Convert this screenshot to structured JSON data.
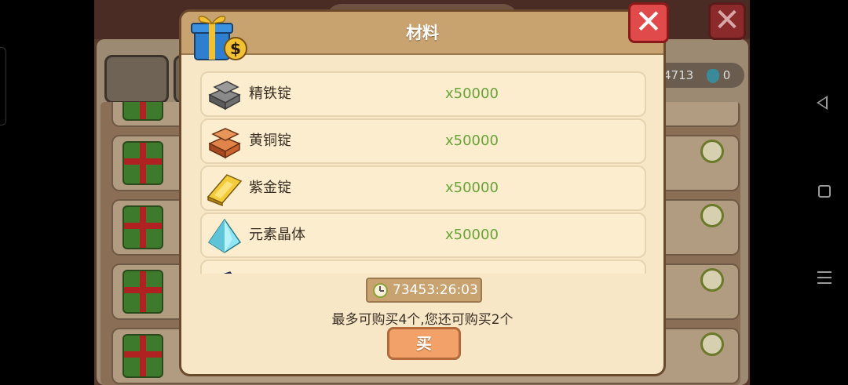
{
  "dialog": {
    "title": "材料",
    "items": [
      {
        "name": "精铁锭",
        "qty": "x50000",
        "icon": "iron-ingot-icon",
        "color": "#6e6e6e"
      },
      {
        "name": "黄铜锭",
        "qty": "x50000",
        "icon": "copper-ingot-icon",
        "color": "#c8632f"
      },
      {
        "name": "紫金锭",
        "qty": "x50000",
        "icon": "gold-ingot-icon",
        "color": "#e7b21e"
      },
      {
        "name": "元素晶体",
        "qty": "x50000",
        "icon": "element-crystal-icon",
        "color": "#5fd0e6"
      }
    ],
    "timer": "73453:26:03",
    "limit_text": "最多可购买4个,您还可购买2个",
    "buy_label": "买"
  },
  "background": {
    "resource_value": "4713",
    "potion_value": "0"
  },
  "colors": {
    "qty_green": "#6aa23a",
    "header_tan": "#c8a36f",
    "close_red": "#e04a4a",
    "buy_orange": "#f2a268"
  }
}
